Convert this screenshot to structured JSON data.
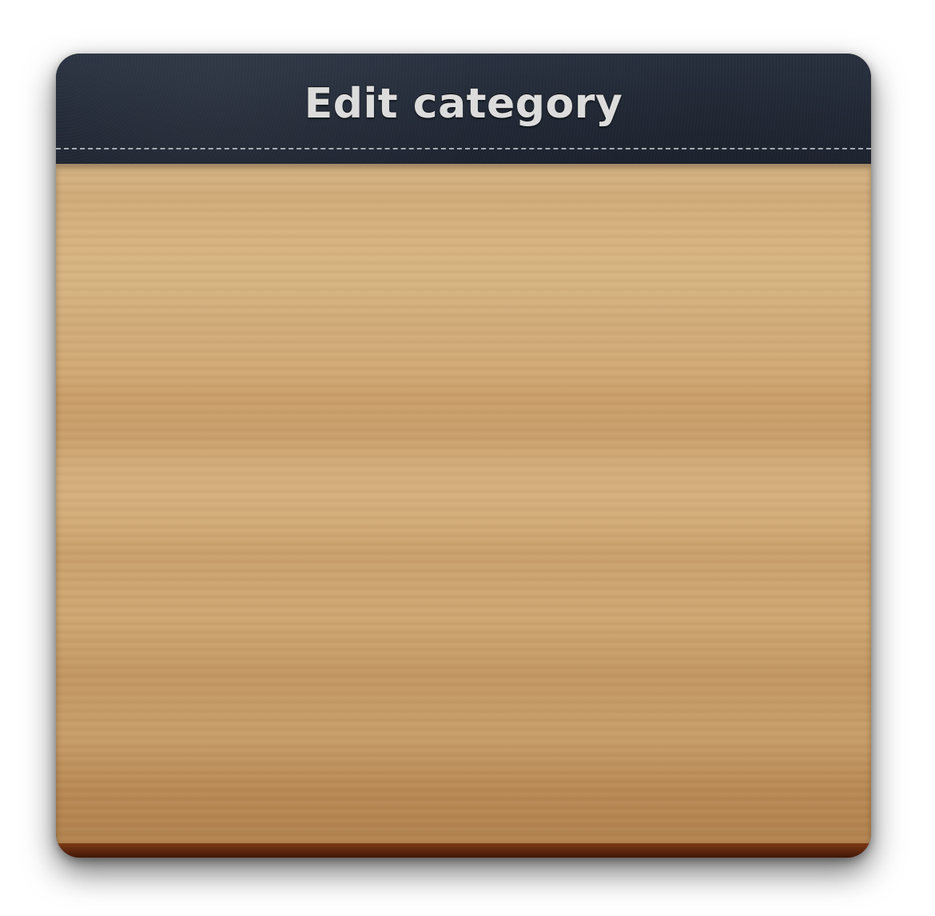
{
  "dialog": {
    "title": "Edit category"
  },
  "theme": {
    "header_color": "#232a37",
    "title_color": "#dcdcdc",
    "wood_light": "#d8b686",
    "wood_dark": "#ae7f4b",
    "edge_color": "#5a240c"
  }
}
